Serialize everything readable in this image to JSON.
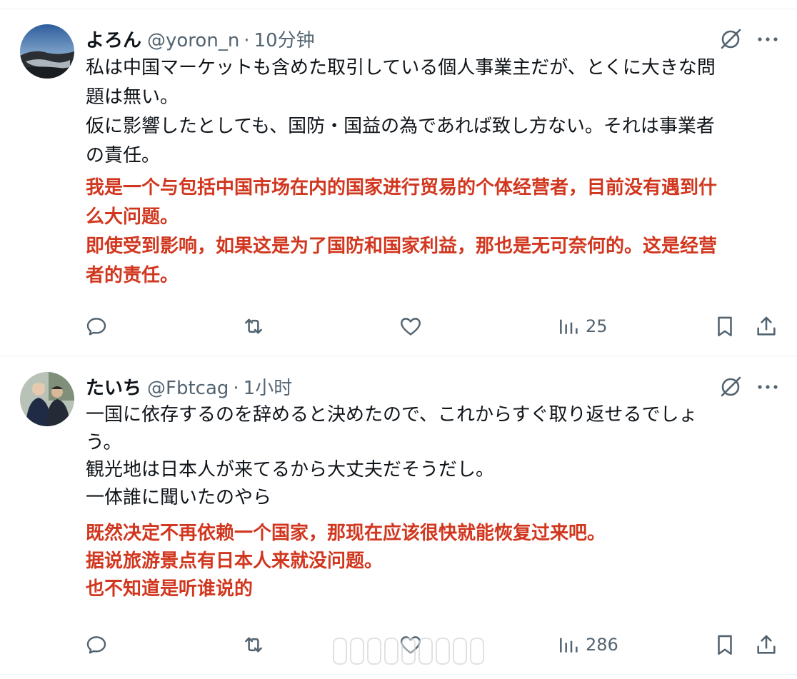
{
  "tweets": [
    {
      "display_name": "よろん",
      "handle": "@yoron_n",
      "separator": "·",
      "time": "10分钟",
      "text": "私は中国マーケットも含めた取引している個人事業主だが、とくに大きな問\n題は無い。\n仮に影響したとしても、国防・国益の為であれば致し方ない。それは事業者\nの責任。",
      "translation": "我是一个与包括中国市场在内的国家进行贸易的个体经营者，目前没有遇到什\n么大问题。\n即使受到影响，如果这是为了国防和国家利益，那也是无可奈何的。这是经营\n者的责任。",
      "views": "25"
    },
    {
      "display_name": "たいち",
      "handle": "@Fbtcag",
      "separator": "·",
      "time": "1小时",
      "text": "一国に依存するのを辞めると決めたので、これからすぐ取り返せるでしょ\nう。\n観光地は日本人が来てるから大丈夫だそうだし。\n一体誰に聞いたのやら",
      "translation": "既然决定不再依赖一个国家，那现在应该很快就能恢复过来吧。\n据说旅游景点有日本人来就没问题。\n也不知道是听谁说的",
      "views": "286"
    }
  ],
  "colors": {
    "translation": "#d1361e",
    "secondary_text": "#536471",
    "primary_text": "#0f1419",
    "divider": "#eff3f4"
  },
  "icons": [
    "grok-icon",
    "more-icon",
    "reply-icon",
    "retweet-icon",
    "like-icon",
    "views-icon",
    "bookmark-icon",
    "share-icon"
  ]
}
